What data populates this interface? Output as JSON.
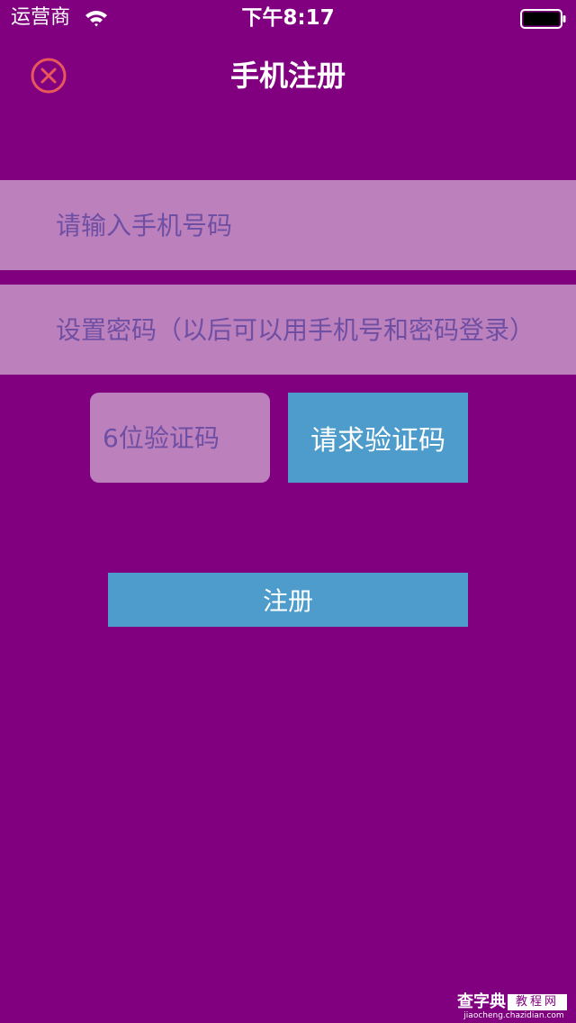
{
  "status_bar": {
    "carrier": "运营商",
    "time": "下午8:17"
  },
  "nav": {
    "title": "手机注册"
  },
  "form": {
    "phone_placeholder": "请输入手机号码",
    "password_placeholder": "设置密码（以后可以用手机号和密码登录）",
    "code_placeholder": "6位验证码",
    "request_code_label": "请求验证码",
    "register_label": "注册"
  },
  "watermark": {
    "main": "查字典",
    "box": "教程网",
    "sub": "jiaocheng.chazidian.com"
  },
  "colors": {
    "background": "#800080",
    "field": "#bc80bd",
    "button": "#4e9ccb",
    "close_icon": "#e8585b"
  }
}
